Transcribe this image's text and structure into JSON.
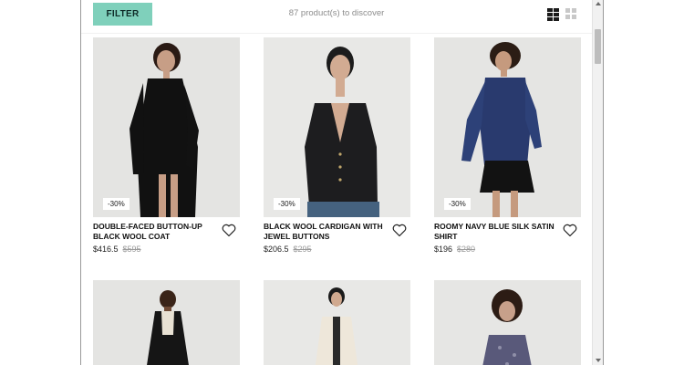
{
  "toolbar": {
    "filter_label": "FILTER",
    "product_count": "87 product(s) to discover",
    "view_list_icon": "list-view-icon",
    "view_grid_icon": "grid-view-icon"
  },
  "products": [
    {
      "name": "DOUBLE-FACED BUTTON-UP BLACK WOOL COAT",
      "price": "$416.5",
      "old_price": "$595",
      "discount": "-30%"
    },
    {
      "name": "BLACK WOOL CARDIGAN WITH JEWEL BUTTONS",
      "price": "$206.5",
      "old_price": "$295",
      "discount": "-30%"
    },
    {
      "name": "ROOMY NAVY BLUE SILK SATIN SHIRT",
      "price": "$196",
      "old_price": "$280",
      "discount": "-30%"
    }
  ],
  "colors": {
    "filter_button": "#7fd0bb",
    "page_background": "#ffffff",
    "photo_background": "#e2e2e0"
  }
}
